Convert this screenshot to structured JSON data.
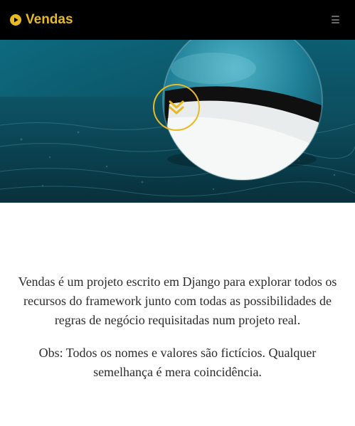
{
  "navbar": {
    "brand_label": "Vendas",
    "brand_icon": "play-circle-icon",
    "menu_icon": "hamburger-menu-icon"
  },
  "hero": {
    "scroll_icon": "double-chevron-down-icon"
  },
  "intro": {
    "paragraph_1": "Vendas é um projeto escrito em Django para explorar todos os recursos do framework junto com todas as possibilidades de regras de negócio requisitadas num projeto real.",
    "paragraph_2": "Obs: Todos os nomes e valores são fictícios. Qualquer semelhança é mera coincidência."
  },
  "colors": {
    "accent": "#e8b923",
    "navbar_bg": "#000000",
    "text": "#2b2b2b",
    "hero_teal": "#0b4a5c"
  }
}
